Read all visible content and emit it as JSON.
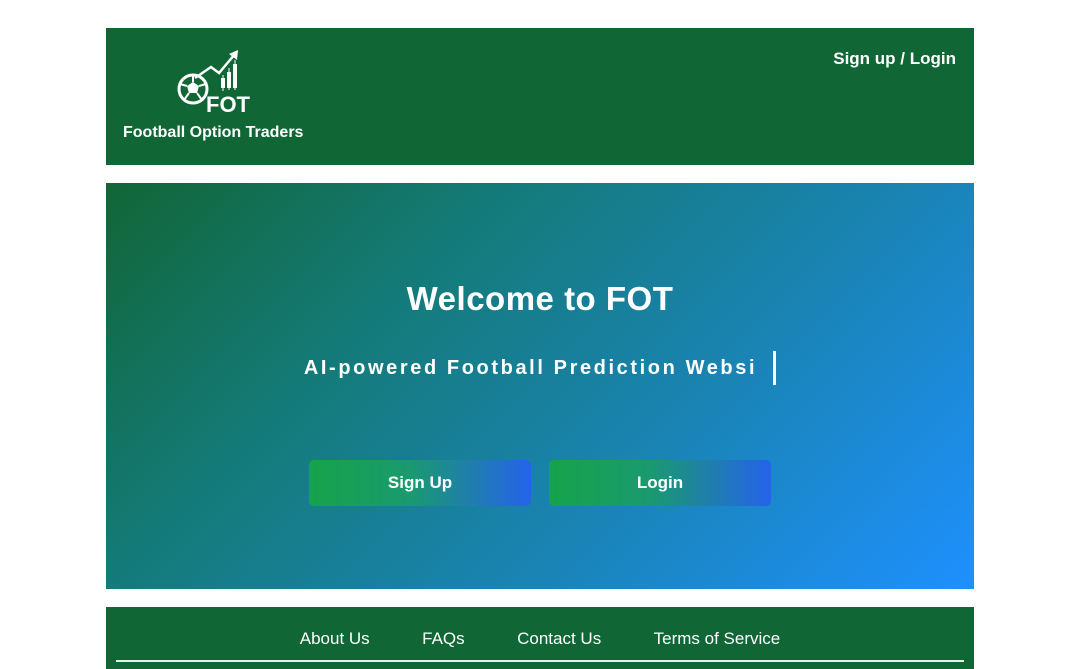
{
  "header": {
    "brand_logo_text": "FOT",
    "brand_name": "Football Option Traders",
    "auth_link": "Sign up / Login"
  },
  "hero": {
    "title": "Welcome to FOT",
    "typing_text": "AI-powered Football Prediction Websi",
    "signup_button": "Sign Up",
    "login_button": "Login"
  },
  "footer": {
    "links": [
      "About Us",
      "FAQs",
      "Contact Us",
      "Terms of Service"
    ]
  },
  "colors": {
    "brand_green": "#116636",
    "hero_gradient_end": "#1e90ff",
    "button_green": "#16a34a",
    "button_blue": "#2563eb"
  },
  "icons": {
    "logo": "soccer-ball-chart-icon"
  }
}
